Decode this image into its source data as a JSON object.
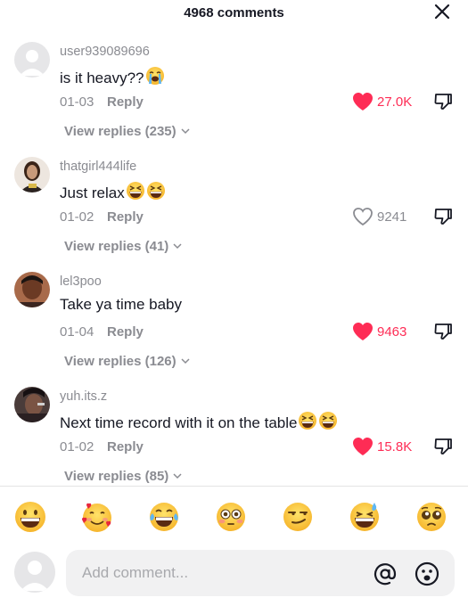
{
  "header": {
    "title": "4968 comments"
  },
  "colors": {
    "accent": "#fe2c55",
    "muted": "#8a8b91",
    "text": "#161823"
  },
  "comments": [
    {
      "username": "user939089696",
      "text": "is it heavy??",
      "text_emoji": "loudly-crying-face",
      "date": "01-03",
      "reply_label": "Reply",
      "likes": "27.0K",
      "liked": true,
      "view_replies": "View replies (235)"
    },
    {
      "username": "thatgirl444life",
      "text": "Just relax",
      "text_emoji": "grinning-squinting-face x2",
      "date": "01-02",
      "reply_label": "Reply",
      "likes": "9241",
      "liked": false,
      "view_replies": "View replies (41)"
    },
    {
      "username": "lel3poo",
      "text": "Take ya time baby",
      "date": "01-04",
      "reply_label": "Reply",
      "likes": "9463",
      "liked": true,
      "view_replies": "View replies (126)"
    },
    {
      "username": "yuh.its.z",
      "text": "Next time record with it on the table",
      "text_emoji": "grinning-squinting-face x2",
      "date": "01-02",
      "reply_label": "Reply",
      "likes": "15.8K",
      "liked": true,
      "view_replies": "View replies (85)"
    }
  ],
  "quick_emojis": [
    "grinning-face",
    "smiling-face-with-hearts",
    "face-with-tears-of-joy",
    "flushed-face",
    "smirking-face",
    "grinning-face-with-sweat",
    "pleading-face"
  ],
  "composer": {
    "placeholder": "Add comment..."
  }
}
